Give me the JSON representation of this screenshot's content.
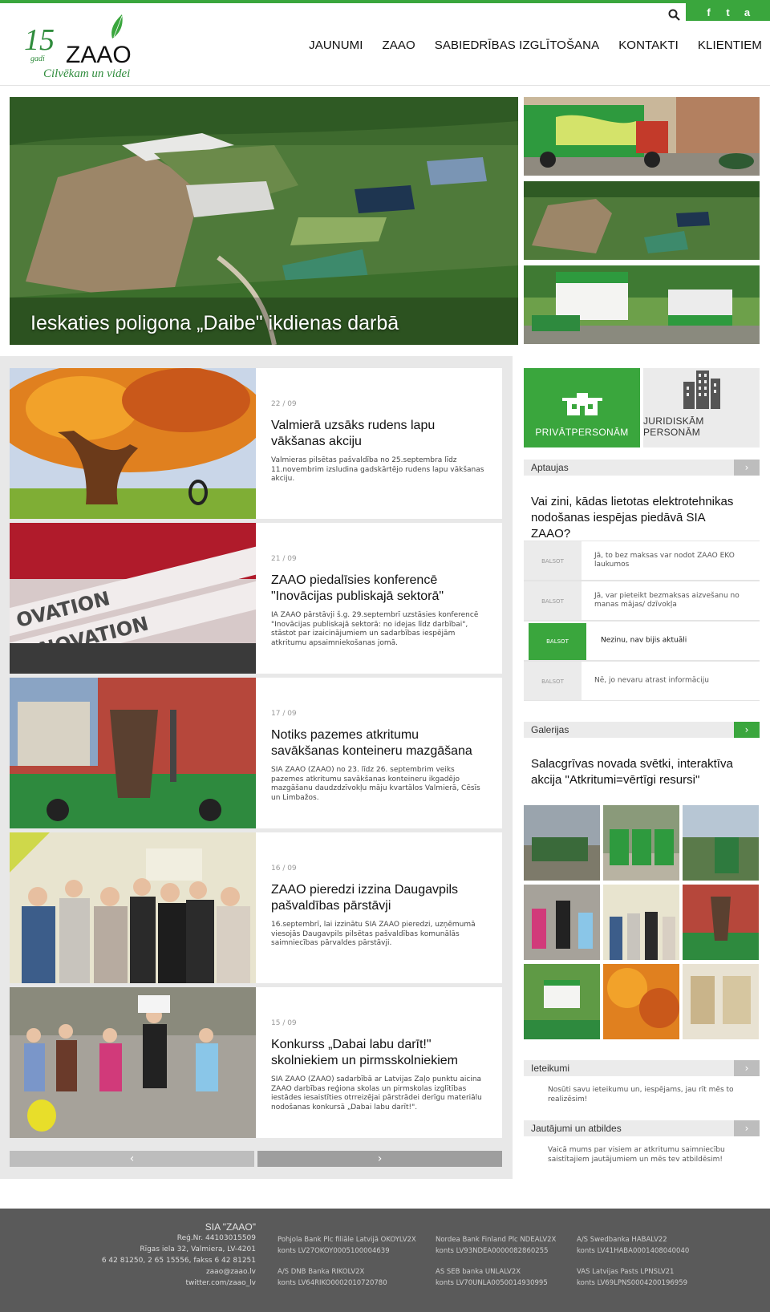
{
  "header": {
    "logo": {
      "number": "15",
      "word": "gadi",
      "brand": "ZAAO",
      "tagline": "Cilvēkam un videi"
    },
    "social": {
      "facebook": "f",
      "twitter": "t",
      "android": "a"
    },
    "nav": [
      "JAUNUMI",
      "ZAAO",
      "SABIEDRĪBAS IZGLĪTOŠANA",
      "KONTAKTI",
      "KLIENTIEM"
    ]
  },
  "hero": {
    "caption": "Ieskaties poligona „Daibe\" ikdienas darbā"
  },
  "news": [
    {
      "date": "22 / 09",
      "title": "Valmierā uzsāks rudens lapu vākšanas akciju",
      "excerpt": "Valmieras pilsētas pašvaldība no 25.septembra līdz 11.novembrim izsludina gadskārtējo rudens lapu vākšanas akciju."
    },
    {
      "date": "21 / 09",
      "title": "ZAAO piedalīsies konferencē \"Inovācijas publiskajā sektorā\"",
      "excerpt": "IA ZAAO pārstāvji š.g. 29.septembrī uzstāsies konferencē \"Inovācijas publiskajā sektorā: no idejas līdz darbībai\", stāstot par izaicinājumiem un sadarbības iespējām atkritumu apsaimniekošanas jomā."
    },
    {
      "date": "17 / 09",
      "title": "Notiks pazemes atkritumu savākšanas konteineru mazgāšana",
      "excerpt": "SIA ZAAO (ZAAO) no 23. līdz 26. septembrim veiks pazemes atkritumu savākšanas konteineru ikgadējo mazgāšanu daudzdzīvokļu māju kvartālos Valmierā, Cēsīs un Limbažos."
    },
    {
      "date": "16 / 09",
      "title": "ZAAO pieredzi izzina Daugavpils pašvaldības pārstāvji",
      "excerpt": "16.septembrī, lai izzinātu SIA ZAAO pieredzi, uzņēmumā viesojās Daugavpils pilsētas pašvaldības komunālās saimniecības pārvaldes pārstāvji."
    },
    {
      "date": "15 / 09",
      "title": "Konkurss „Dabai labu darīt!\" skolniekiem un pirmsskolniekiem",
      "excerpt": "SIA ZAAO (ZAAO) sadarbībā ar Latvijas Zaļo punktu aicina ZAAO darbības reģiona skolas un pirmskolas izglītības iestādes iesaistīties otrreizējai pārstrādei derīgu materiālu nodošanas konkursā „Dabai labu darīt!\"."
    }
  ],
  "news_images": [
    "autumn-tree-photo",
    "innovation-keyboard-photo",
    "container-washing-photo",
    "group-photo",
    "children-photo"
  ],
  "pager": {
    "prev": "‹",
    "next": "›"
  },
  "sidebar": {
    "private_label": "PRIVĀTPERSONĀM",
    "legal_label": "JURIDISKĀM PERSONĀM",
    "poll_header": "Aptaujas",
    "poll_question": "Vai zini, kādas lietotas elektrotehnikas nodošanas iespējas piedāvā SIA ZAAO?",
    "vote_label": "BALSOT",
    "poll_options": [
      "Jā, to bez maksas var nodot ZAAO EKO laukumos",
      "Jā, var pieteikt bezmaksas aizvešanu no manas mājas/ dzīvokļa",
      "Nezinu, nav bijis aktuāli",
      "Nē, jo nevaru atrast informāciju"
    ],
    "gallery_header": "Galerijas",
    "gallery_title": "Salacgrīvas novada svētki, interaktīva akcija \"Atkritumi=vērtīgi resursi\"",
    "suggestions_header": "Ieteikumi",
    "suggestions_text": "Nosūti savu ieteikumu un, iespējams, jau rīt mēs to realizēsim!",
    "qa_header": "Jautājumi un atbildes",
    "qa_text": "Vaicā mums par visiem ar atkritumu saimniecību saistītajiem jautājumiem un mēs tev atbildēsim!",
    "arrow": "›"
  },
  "footer": {
    "company": "SIA \"ZAAO\"",
    "reg": "Reģ.Nr. 44103015509",
    "address": "Rīgas iela 32, Valmiera, LV-4201",
    "phones": "6 42 81250, 2 65 15556, fakss 6 42 81251",
    "email": "zaao@zaao.lv",
    "twitter": "twitter.com/zaao_lv",
    "banks": [
      {
        "name": "Pohjola Bank Plc filiāle Latvijā OKOYLV2X",
        "account": "konts LV27OKOY0005100004639"
      },
      {
        "name": "Nordea Bank Finland Plc NDEALV2X",
        "account": "konts LV93NDEA0000082860255"
      },
      {
        "name": "A/S Swedbanka HABALV22",
        "account": "konts LV41HABA0001408040040"
      },
      {
        "name": "A/S DNB Banka RIKOLV2X",
        "account": "konts LV64RIKO0002010720780"
      },
      {
        "name": "AS SEB banka UNLALV2X",
        "account": "konts LV70UNLA0050014930995"
      },
      {
        "name": "VAS Latvijas Pasts LPNSLV21",
        "account": "konts LV69LPNS0004200196959"
      }
    ]
  },
  "colors": {
    "accent": "#3aa63d",
    "gray_button": "#bdbdbd",
    "footer_bg": "#5a5a5a"
  }
}
